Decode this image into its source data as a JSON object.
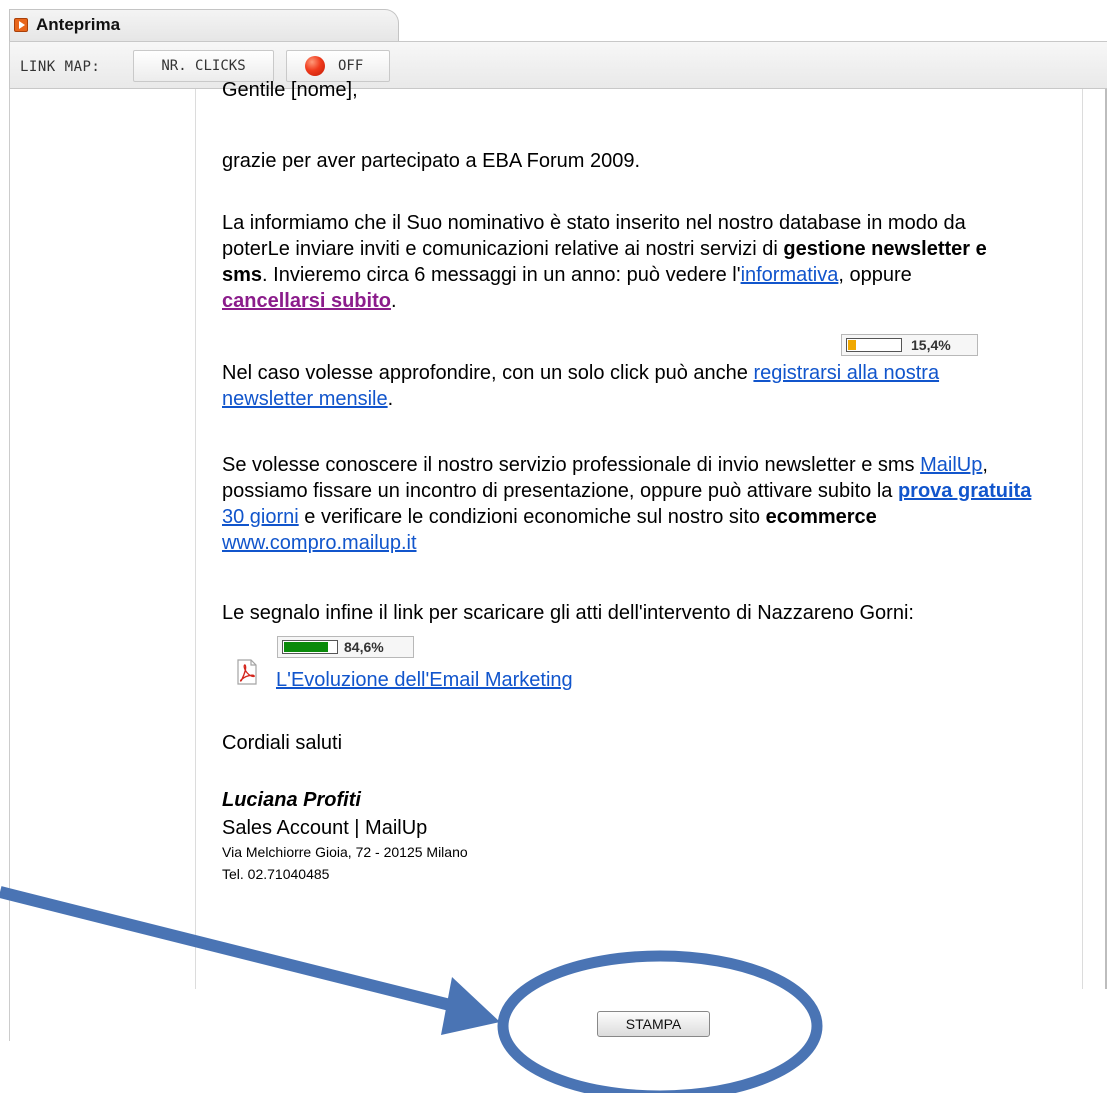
{
  "tab": {
    "title": "Anteprima",
    "icon": "play-icon"
  },
  "toolbar": {
    "label": "LINK MAP:",
    "clicks_label": "NR. CLICKS",
    "toggle_label": "OFF",
    "toggle_color": "#e8321a"
  },
  "email": {
    "greeting": "Gentile [nome],",
    "p1": "grazie per aver partecipato a EBA Forum 2009.",
    "p2_a": "La informiamo che il Suo nominativo è stato inserito nel nostro database in modo da poterLe inviare inviti e comunicazioni relative ai nostri servizi di ",
    "p2_bold": "gestione newsletter e sms",
    "p2_b": ". Invieremo circa 6 messaggi in un anno: può vedere l'",
    "p2_link1": "informativa",
    "p2_c": ", oppure ",
    "p2_link2": "cancellarsi subito",
    "p2_d": ".",
    "p3_a": "Nel caso volesse approfondire, con un solo click può anche ",
    "p3_link": "registrarsi alla nostra newsletter mensile",
    "p3_b": ".",
    "p4_a": "Se volesse conoscere il nostro servizio professionale di invio newsletter e sms ",
    "p4_link1": "MailUp",
    "p4_b": ", possiamo fissare un incontro di presentazione, oppure può attivare subito la ",
    "p4_link2_bold": "prova gratuita",
    "p4_link2_rest": " 30 giorni",
    "p4_c": " e verificare le condizioni economiche sul nostro sito ",
    "p4_bold": "ecommerce",
    "p4_d": " ",
    "p4_link3": "www.compro.mailup.it",
    "p5": "Le segnalo infine il link per scaricare gli atti dell'intervento di Nazzareno Gorni:",
    "pdf_link": "L'Evoluzione dell'Email Marketing",
    "closing": "Cordiali saluti",
    "sig_name": "Luciana Profiti",
    "sig_role": "Sales Account | MailUp",
    "sig_address": "Via Melchiorre Gioia, 72 - 20125 Milano",
    "sig_tel": "Tel. 02.71040485"
  },
  "link_stats": [
    {
      "label": "15,4%",
      "fraction": 0.154,
      "color": "#f0a800"
    },
    {
      "label": "84,6%",
      "fraction": 0.846,
      "color": "#0a8a0a"
    }
  ],
  "print_button": "STAMPA",
  "annotation_color": "#4a74b4"
}
